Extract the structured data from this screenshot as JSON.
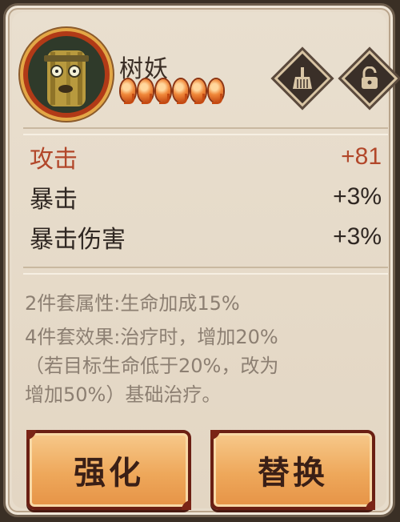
{
  "character": {
    "name": "树妖",
    "star_count": 6
  },
  "icons": {
    "left": "broom-icon",
    "right": "unlock-icon"
  },
  "stats": [
    {
      "label": "攻击",
      "value": "+81",
      "highlight": true
    },
    {
      "label": "暴击",
      "value": "+3%",
      "highlight": false
    },
    {
      "label": "暴击伤害",
      "value": "+3%",
      "highlight": false
    }
  ],
  "set_bonus": {
    "two_piece": "2件套属性:生命加成15%",
    "four_piece_line1": "4件套效果:治疗时，增加20%",
    "four_piece_line2": "（若目标生命低于20%，改为",
    "four_piece_line3": "增加50%）基础治疗。"
  },
  "buttons": {
    "enhance": "强化",
    "replace": "替换"
  },
  "colors": {
    "highlight_stat": "#b2472a",
    "button_fill": "#eea85b",
    "button_border": "#6a1f13",
    "panel_bg": "#e7dccb"
  }
}
